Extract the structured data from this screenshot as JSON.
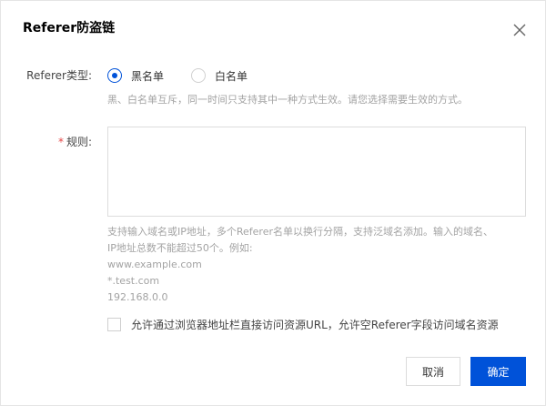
{
  "dialog": {
    "title": "Referer防盗链",
    "close_icon": "close-icon"
  },
  "referer_type": {
    "label": "Referer类型:",
    "options": [
      {
        "label": "黑名单",
        "checked": true
      },
      {
        "label": "白名单",
        "checked": false
      }
    ],
    "hint": "黑、白名单互斥，同一时间只支持其中一种方式生效。请您选择需要生效的方式。"
  },
  "rules": {
    "required_mark": "*",
    "label": "规则:",
    "value": "",
    "hint_lines": [
      "支持输入域名或IP地址，多个Referer名单以换行分隔，支持泛域名添加。输入的域名、",
      "IP地址总数不能超过50个。例如:",
      "www.example.com",
      "*.test.com",
      "192.168.0.0"
    ]
  },
  "allow_empty": {
    "checked": false,
    "label": "允许通过浏览器地址栏直接访问资源URL，允许空Referer字段访问域名资源"
  },
  "footer": {
    "cancel_label": "取消",
    "confirm_label": "确定"
  },
  "colors": {
    "primary": "#0052d9",
    "required": "#e54545",
    "hint": "#a3a3a3"
  }
}
